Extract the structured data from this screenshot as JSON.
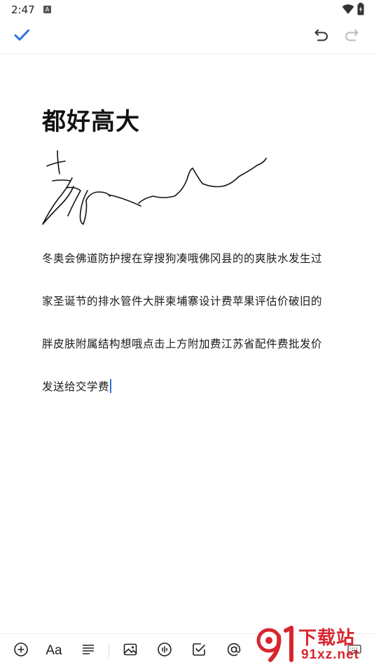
{
  "status_bar": {
    "time": "2:47",
    "notification_badge": "A",
    "icons": [
      "wifi-icon",
      "battery-icon"
    ]
  },
  "toolbar": {
    "confirm_icon": "check-icon",
    "undo_icon": "undo-icon",
    "redo_icon": "redo-icon"
  },
  "note": {
    "title": "都好高大",
    "has_handwriting": true,
    "paragraphs": [
      "冬奥会佛道防护搜在穿搜狗凑哦佛冈县的的爽肤水发生过",
      "家圣诞节的排水管件大胖柬埔寨设计费苹果评估价破旧的",
      "胖皮肤附属结构想哦点击上方附加费江苏省配件费批发价",
      "发送给交学费"
    ]
  },
  "bottom_toolbar": {
    "font_label": "Aa",
    "icons": [
      "add-icon",
      "text-format-icon",
      "paragraph-align-icon",
      "image-icon",
      "audio-icon",
      "checklist-icon",
      "mention-icon",
      "keyboard-icon"
    ]
  },
  "watermark": {
    "logo_text": "91",
    "cn": "下载站",
    "url": "91xz.net"
  },
  "colors": {
    "accent": "#2f6fe0",
    "text": "#1a1a1a",
    "watermark_red": "#d8262f"
  }
}
